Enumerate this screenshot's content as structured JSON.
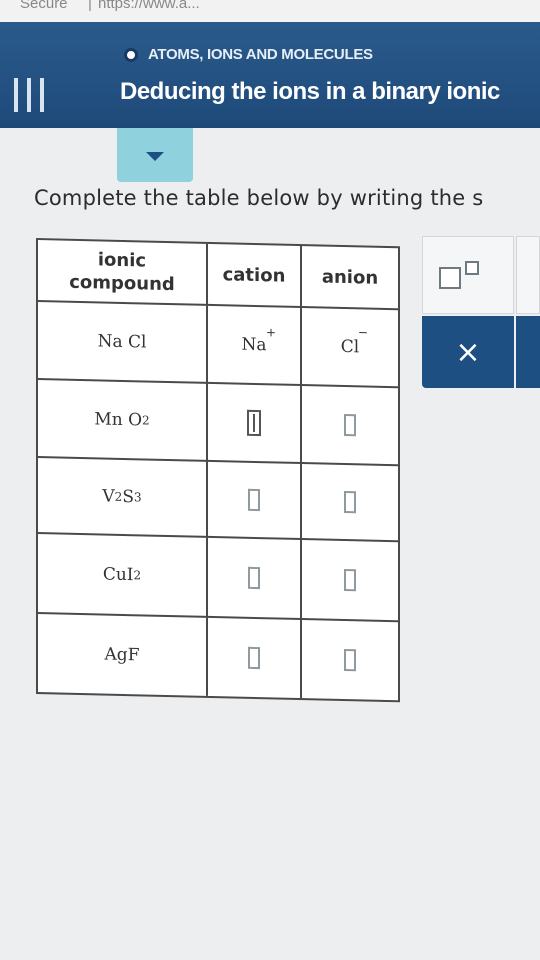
{
  "browser": {
    "secure_label": "Secure",
    "separator": "|",
    "url_fragment": "https://www.a..."
  },
  "header": {
    "topic": "ATOMS, IONS AND MOLECULES",
    "title": "Deducing the ions in a binary ionic"
  },
  "instructions": "Complete the table below by writing the s",
  "table": {
    "headers": [
      "ionic compound",
      "cation",
      "anion"
    ],
    "header_ionic_line1": "ionic",
    "header_ionic_line2": "compound",
    "rows": [
      {
        "compound_parts": [
          "Na",
          "Cl"
        ],
        "cation": "Na",
        "cation_charge": "+",
        "anion": "Cl",
        "anion_charge": "−"
      },
      {
        "compound_parts": [
          "Mn",
          "O",
          "2"
        ],
        "cation": "",
        "anion": ""
      },
      {
        "compound_parts": [
          "V",
          "2",
          "S",
          "3"
        ],
        "cation": "",
        "anion": ""
      },
      {
        "compound_parts": [
          "Cu",
          "I",
          "2"
        ],
        "cation": "",
        "anion": ""
      },
      {
        "compound_parts": [
          "Ag",
          "F"
        ],
        "cation": "",
        "anion": ""
      }
    ]
  },
  "tools": {
    "clear_symbol": "×"
  },
  "icons": [
    "menu-icon",
    "chevron-down-icon",
    "superscript-icon",
    "close-icon"
  ],
  "colors": {
    "header_bg": "#1e4a79",
    "tab": "#8fd1dc",
    "button": "#1d4f83"
  }
}
